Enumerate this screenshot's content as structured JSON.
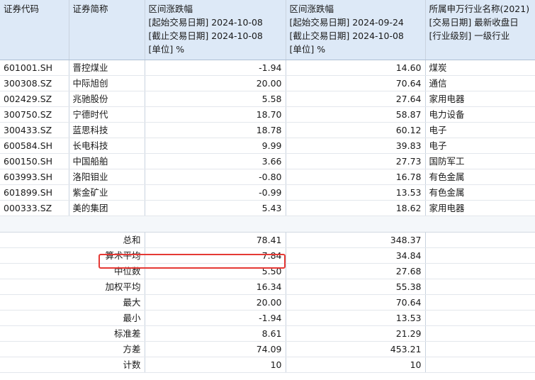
{
  "headers": {
    "code": "证券代码",
    "name": "证券简称",
    "chg1": {
      "title": "区间涨跌幅",
      "start": "[起始交易日期] 2024-10-08",
      "end": "[截止交易日期] 2024-10-08",
      "unit": "[单位] %"
    },
    "chg2": {
      "title": "区间涨跌幅",
      "start": "[起始交易日期] 2024-09-24",
      "end": "[截止交易日期] 2024-10-08",
      "unit": "[单位] %"
    },
    "industry": {
      "title": "所属申万行业名称(2021)",
      "date": "[交易日期] 最新收盘日",
      "level": "[行业级别] 一级行业"
    }
  },
  "rows": [
    {
      "code": "601001.SH",
      "name": "晋控煤业",
      "chg1": "-1.94",
      "chg2": "14.60",
      "industry": "煤炭"
    },
    {
      "code": "300308.SZ",
      "name": "中际旭创",
      "chg1": "20.00",
      "chg2": "70.64",
      "industry": "通信"
    },
    {
      "code": "002429.SZ",
      "name": "兆驰股份",
      "chg1": "5.58",
      "chg2": "27.64",
      "industry": "家用电器"
    },
    {
      "code": "300750.SZ",
      "name": "宁德时代",
      "chg1": "18.70",
      "chg2": "58.87",
      "industry": "电力设备"
    },
    {
      "code": "300433.SZ",
      "name": "蓝思科技",
      "chg1": "18.78",
      "chg2": "60.12",
      "industry": "电子"
    },
    {
      "code": "600584.SH",
      "name": "长电科技",
      "chg1": "9.99",
      "chg2": "39.83",
      "industry": "电子"
    },
    {
      "code": "600150.SH",
      "name": "中国船舶",
      "chg1": "3.66",
      "chg2": "27.73",
      "industry": "国防军工"
    },
    {
      "code": "603993.SH",
      "name": "洛阳钼业",
      "chg1": "-0.80",
      "chg2": "16.78",
      "industry": "有色金属"
    },
    {
      "code": "601899.SH",
      "name": "紫金矿业",
      "chg1": "-0.99",
      "chg2": "13.53",
      "industry": "有色金属"
    },
    {
      "code": "000333.SZ",
      "name": "美的集团",
      "chg1": "5.43",
      "chg2": "18.62",
      "industry": "家用电器"
    }
  ],
  "stats": [
    {
      "label": "总和",
      "chg1": "78.41",
      "chg2": "348.37"
    },
    {
      "label": "算术平均",
      "chg1": "7.84",
      "chg2": "34.84",
      "highlighted": true
    },
    {
      "label": "中位数",
      "chg1": "5.50",
      "chg2": "27.68"
    },
    {
      "label": "加权平均",
      "chg1": "16.34",
      "chg2": "55.38"
    },
    {
      "label": "最大",
      "chg1": "20.00",
      "chg2": "70.64"
    },
    {
      "label": "最小",
      "chg1": "-1.94",
      "chg2": "13.53"
    },
    {
      "label": "标准差",
      "chg1": "8.61",
      "chg2": "21.29"
    },
    {
      "label": "方差",
      "chg1": "74.09",
      "chg2": "453.21"
    },
    {
      "label": "计数",
      "chg1": "10",
      "chg2": "10"
    }
  ],
  "colors": {
    "header_bg": "#dde9f7",
    "highlight_border": "#e53935",
    "gridline": "#c9d3df"
  }
}
